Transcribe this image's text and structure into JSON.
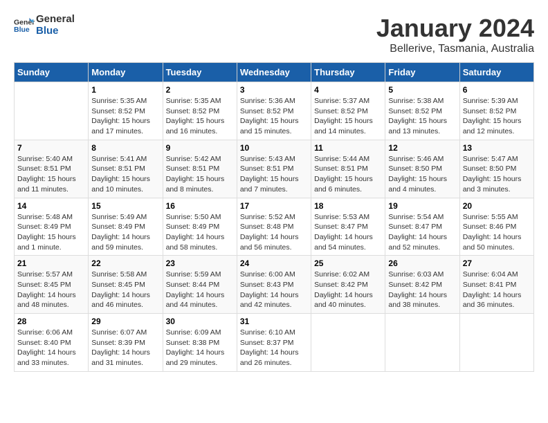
{
  "logo": {
    "line1": "General",
    "line2": "Blue"
  },
  "title": "January 2024",
  "subtitle": "Bellerive, Tasmania, Australia",
  "headers": [
    "Sunday",
    "Monday",
    "Tuesday",
    "Wednesday",
    "Thursday",
    "Friday",
    "Saturday"
  ],
  "weeks": [
    [
      {
        "num": "",
        "info": ""
      },
      {
        "num": "1",
        "info": "Sunrise: 5:35 AM\nSunset: 8:52 PM\nDaylight: 15 hours\nand 17 minutes."
      },
      {
        "num": "2",
        "info": "Sunrise: 5:35 AM\nSunset: 8:52 PM\nDaylight: 15 hours\nand 16 minutes."
      },
      {
        "num": "3",
        "info": "Sunrise: 5:36 AM\nSunset: 8:52 PM\nDaylight: 15 hours\nand 15 minutes."
      },
      {
        "num": "4",
        "info": "Sunrise: 5:37 AM\nSunset: 8:52 PM\nDaylight: 15 hours\nand 14 minutes."
      },
      {
        "num": "5",
        "info": "Sunrise: 5:38 AM\nSunset: 8:52 PM\nDaylight: 15 hours\nand 13 minutes."
      },
      {
        "num": "6",
        "info": "Sunrise: 5:39 AM\nSunset: 8:52 PM\nDaylight: 15 hours\nand 12 minutes."
      }
    ],
    [
      {
        "num": "7",
        "info": "Sunrise: 5:40 AM\nSunset: 8:51 PM\nDaylight: 15 hours\nand 11 minutes."
      },
      {
        "num": "8",
        "info": "Sunrise: 5:41 AM\nSunset: 8:51 PM\nDaylight: 15 hours\nand 10 minutes."
      },
      {
        "num": "9",
        "info": "Sunrise: 5:42 AM\nSunset: 8:51 PM\nDaylight: 15 hours\nand 8 minutes."
      },
      {
        "num": "10",
        "info": "Sunrise: 5:43 AM\nSunset: 8:51 PM\nDaylight: 15 hours\nand 7 minutes."
      },
      {
        "num": "11",
        "info": "Sunrise: 5:44 AM\nSunset: 8:51 PM\nDaylight: 15 hours\nand 6 minutes."
      },
      {
        "num": "12",
        "info": "Sunrise: 5:46 AM\nSunset: 8:50 PM\nDaylight: 15 hours\nand 4 minutes."
      },
      {
        "num": "13",
        "info": "Sunrise: 5:47 AM\nSunset: 8:50 PM\nDaylight: 15 hours\nand 3 minutes."
      }
    ],
    [
      {
        "num": "14",
        "info": "Sunrise: 5:48 AM\nSunset: 8:49 PM\nDaylight: 15 hours\nand 1 minute."
      },
      {
        "num": "15",
        "info": "Sunrise: 5:49 AM\nSunset: 8:49 PM\nDaylight: 14 hours\nand 59 minutes."
      },
      {
        "num": "16",
        "info": "Sunrise: 5:50 AM\nSunset: 8:49 PM\nDaylight: 14 hours\nand 58 minutes."
      },
      {
        "num": "17",
        "info": "Sunrise: 5:52 AM\nSunset: 8:48 PM\nDaylight: 14 hours\nand 56 minutes."
      },
      {
        "num": "18",
        "info": "Sunrise: 5:53 AM\nSunset: 8:47 PM\nDaylight: 14 hours\nand 54 minutes."
      },
      {
        "num": "19",
        "info": "Sunrise: 5:54 AM\nSunset: 8:47 PM\nDaylight: 14 hours\nand 52 minutes."
      },
      {
        "num": "20",
        "info": "Sunrise: 5:55 AM\nSunset: 8:46 PM\nDaylight: 14 hours\nand 50 minutes."
      }
    ],
    [
      {
        "num": "21",
        "info": "Sunrise: 5:57 AM\nSunset: 8:45 PM\nDaylight: 14 hours\nand 48 minutes."
      },
      {
        "num": "22",
        "info": "Sunrise: 5:58 AM\nSunset: 8:45 PM\nDaylight: 14 hours\nand 46 minutes."
      },
      {
        "num": "23",
        "info": "Sunrise: 5:59 AM\nSunset: 8:44 PM\nDaylight: 14 hours\nand 44 minutes."
      },
      {
        "num": "24",
        "info": "Sunrise: 6:00 AM\nSunset: 8:43 PM\nDaylight: 14 hours\nand 42 minutes."
      },
      {
        "num": "25",
        "info": "Sunrise: 6:02 AM\nSunset: 8:42 PM\nDaylight: 14 hours\nand 40 minutes."
      },
      {
        "num": "26",
        "info": "Sunrise: 6:03 AM\nSunset: 8:42 PM\nDaylight: 14 hours\nand 38 minutes."
      },
      {
        "num": "27",
        "info": "Sunrise: 6:04 AM\nSunset: 8:41 PM\nDaylight: 14 hours\nand 36 minutes."
      }
    ],
    [
      {
        "num": "28",
        "info": "Sunrise: 6:06 AM\nSunset: 8:40 PM\nDaylight: 14 hours\nand 33 minutes."
      },
      {
        "num": "29",
        "info": "Sunrise: 6:07 AM\nSunset: 8:39 PM\nDaylight: 14 hours\nand 31 minutes."
      },
      {
        "num": "30",
        "info": "Sunrise: 6:09 AM\nSunset: 8:38 PM\nDaylight: 14 hours\nand 29 minutes."
      },
      {
        "num": "31",
        "info": "Sunrise: 6:10 AM\nSunset: 8:37 PM\nDaylight: 14 hours\nand 26 minutes."
      },
      {
        "num": "",
        "info": ""
      },
      {
        "num": "",
        "info": ""
      },
      {
        "num": "",
        "info": ""
      }
    ]
  ]
}
